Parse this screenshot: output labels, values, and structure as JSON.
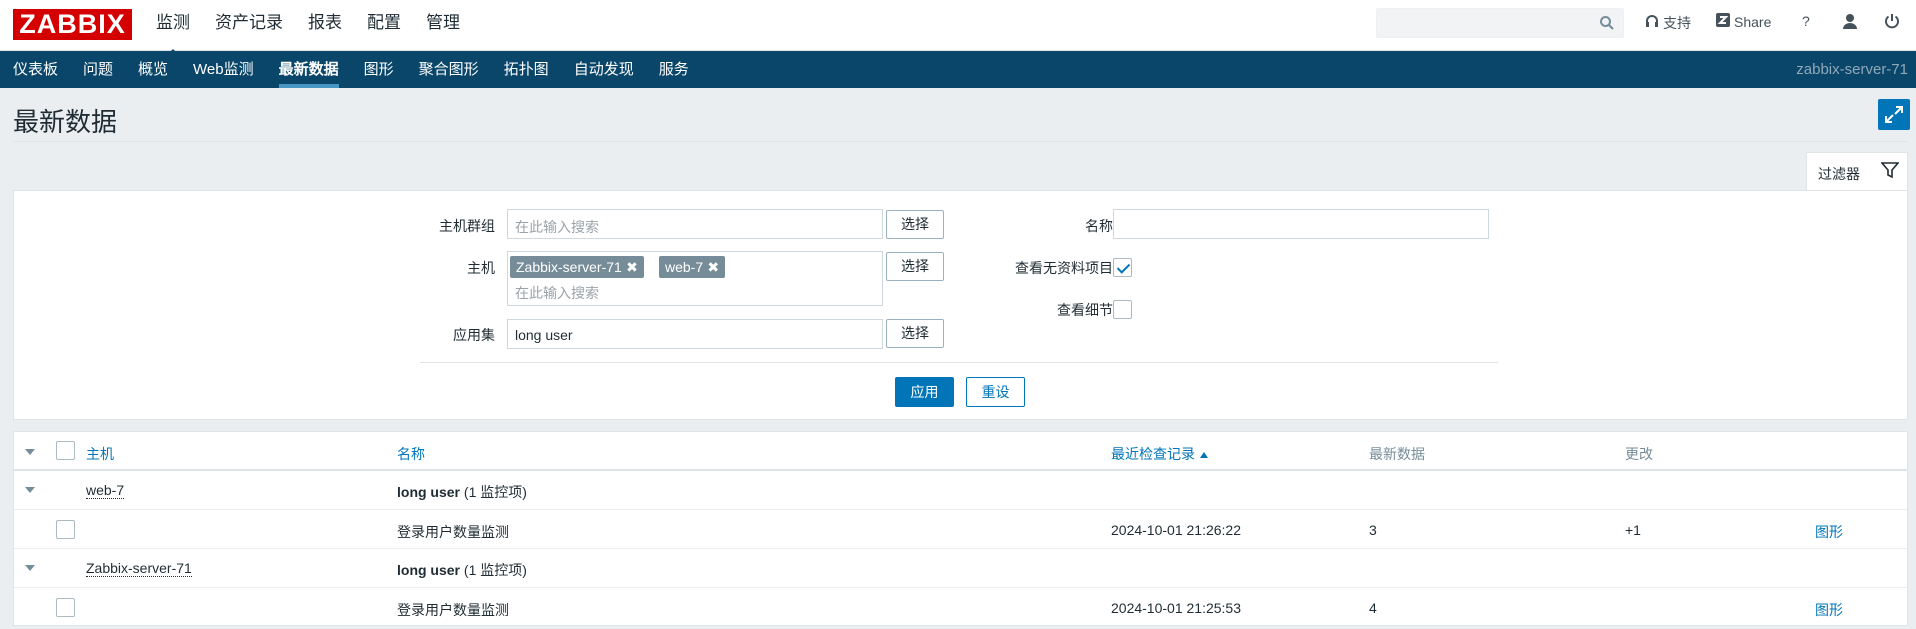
{
  "header": {
    "logo": "ZABBIX",
    "main_menu": [
      "监测",
      "资产记录",
      "报表",
      "配置",
      "管理"
    ],
    "search_placeholder": "",
    "support_label": "支持",
    "share_label": "Share",
    "help_label": "?"
  },
  "subnav": {
    "items": [
      "仪表板",
      "问题",
      "概览",
      "Web监测",
      "最新数据",
      "图形",
      "聚合图形",
      "拓扑图",
      "自动发现",
      "服务"
    ],
    "active": "最新数据",
    "server_name": "zabbix-server-71"
  },
  "page": {
    "title": "最新数据",
    "filter_tab_label": "过滤器"
  },
  "filter": {
    "host_group_label": "主机群组",
    "host_group_placeholder": "在此输入搜索",
    "host_label": "主机",
    "host_tags": [
      "Zabbix-server-71",
      "web-7"
    ],
    "host_placeholder": "在此输入搜索",
    "application_label": "应用集",
    "application_value": "long user",
    "select_label": "选择",
    "name_label": "名称",
    "name_value": "",
    "show_items_without_data_label": "查看无资料项目",
    "show_items_without_data_checked": true,
    "show_details_label": "查看细节",
    "show_details_checked": false,
    "apply_label": "应用",
    "reset_label": "重设"
  },
  "table": {
    "columns": {
      "host": "主机",
      "name": "名称",
      "last_check": "最近检查记录",
      "last_value": "最新数据",
      "change": "更改"
    },
    "groups": [
      {
        "host": "web-7",
        "app_name": "long user",
        "app_count": "(1 监控项)",
        "item": {
          "name": "登录用户数量监测",
          "last_check": "2024-10-01 21:26:22",
          "last_value": "3",
          "change": "+1",
          "graph_link": "图形"
        }
      },
      {
        "host": "Zabbix-server-71",
        "app_name": "long user",
        "app_count": "(1 监控项)",
        "item": {
          "name": "登录用户数量监测",
          "last_check": "2024-10-01 21:25:53",
          "last_value": "4",
          "change": "",
          "graph_link": "图形"
        }
      }
    ]
  }
}
